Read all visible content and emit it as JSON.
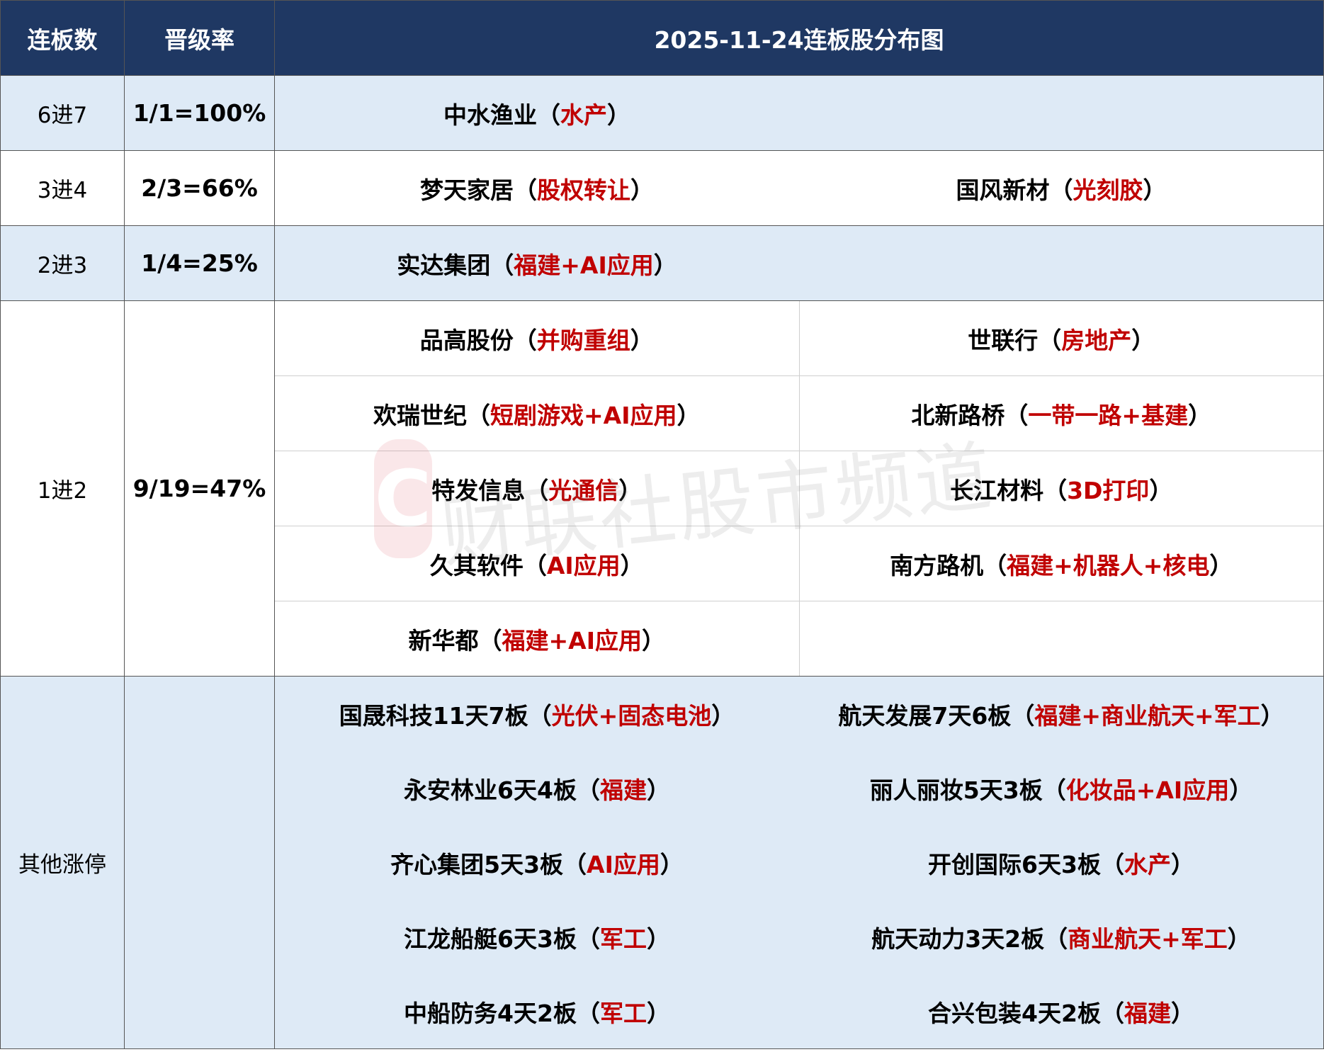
{
  "header": {
    "col_boards": "连板数",
    "col_rate": "晋级率",
    "title": "2025-11-24连板股分布图"
  },
  "rows": {
    "r6": {
      "label": "6进7",
      "rate": "1/1=100%",
      "stocks": [
        {
          "name": "中水渔业",
          "theme": "水产"
        }
      ]
    },
    "r3": {
      "label": "3进4",
      "rate": "2/3=66%",
      "stocks": [
        {
          "name": "梦天家居",
          "theme": "股权转让"
        },
        {
          "name": "国风新材",
          "theme": "光刻胶"
        }
      ]
    },
    "r2": {
      "label": "2进3",
      "rate": "1/4=25%",
      "stocks": [
        {
          "name": "实达集团",
          "theme": "福建+AI应用"
        }
      ]
    },
    "r1": {
      "label": "1进2",
      "rate": "9/19=47%",
      "stocks": [
        {
          "name": "品高股份",
          "theme": "并购重组"
        },
        {
          "name": "世联行",
          "theme": "房地产"
        },
        {
          "name": "欢瑞世纪",
          "theme": "短剧游戏+AI应用"
        },
        {
          "name": "北新路桥",
          "theme": "一带一路+基建"
        },
        {
          "name": "特发信息",
          "theme": "光通信"
        },
        {
          "name": "长江材料",
          "theme": "3D打印"
        },
        {
          "name": "久其软件",
          "theme": "AI应用"
        },
        {
          "name": "南方路机",
          "theme": "福建+机器人+核电"
        },
        {
          "name": "新华都",
          "theme": "福建+AI应用"
        }
      ]
    },
    "other": {
      "label": "其他涨停",
      "stocks": [
        {
          "name": "国晟科技11天7板",
          "theme": "光伏+固态电池"
        },
        {
          "name": "航天发展7天6板",
          "theme": "福建+商业航天+军工"
        },
        {
          "name": "永安林业6天4板",
          "theme": "福建"
        },
        {
          "name": "丽人丽妆5天3板",
          "theme": "化妆品+AI应用"
        },
        {
          "name": "齐心集团5天3板",
          "theme": "AI应用"
        },
        {
          "name": "开创国际6天3板",
          "theme": "水产"
        },
        {
          "name": "江龙船艇6天3板",
          "theme": "军工"
        },
        {
          "name": "航天动力3天2板",
          "theme": "商业航天+军工"
        },
        {
          "name": "中船防务4天2板",
          "theme": "军工"
        },
        {
          "name": "合兴包装4天2板",
          "theme": "福建"
        }
      ]
    }
  },
  "watermark": {
    "logo": "C",
    "text": "财联社股市频道"
  },
  "colors": {
    "header_bg": "#1f3863",
    "row_shade": "#deeaf6",
    "theme": "#c00000"
  }
}
